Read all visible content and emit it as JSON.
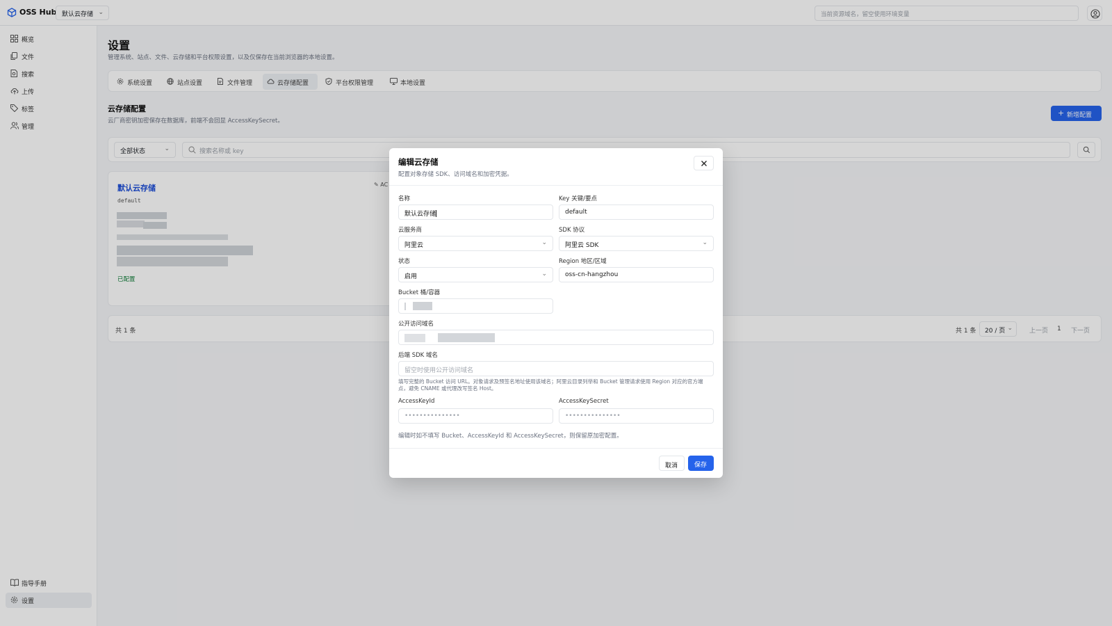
{
  "app": {
    "title": "OSS Hub",
    "bucket_select": "默认云存储"
  },
  "top_search": {
    "placeholder": "当前资源域名，留空使用环境变量"
  },
  "sidebar": {
    "items": [
      {
        "label": "概览",
        "icon": "grid-icon"
      },
      {
        "label": "文件",
        "icon": "files-icon"
      },
      {
        "label": "搜索",
        "icon": "file-search-icon"
      },
      {
        "label": "上传",
        "icon": "cloud-upload-icon"
      },
      {
        "label": "标签",
        "icon": "tags-icon"
      },
      {
        "label": "管理",
        "icon": "users-icon"
      }
    ],
    "bottom": [
      {
        "label": "指导手册",
        "icon": "book-icon"
      },
      {
        "label": "设置",
        "icon": "gear-icon"
      }
    ]
  },
  "page": {
    "title": "设置",
    "subtitle": "管理系统、站点、文件、云存储和平台权限设置，以及仅保存在当前浏览器的本地设置。"
  },
  "tabs": [
    {
      "label": "系统设置",
      "icon": "gear-icon"
    },
    {
      "label": "站点设置",
      "icon": "globe-icon"
    },
    {
      "label": "文件管理",
      "icon": "file-icon"
    },
    {
      "label": "云存储配置",
      "icon": "cloud-icon",
      "active": true
    },
    {
      "label": "平台权限管理",
      "icon": "shield-icon"
    },
    {
      "label": "本地设置",
      "icon": "monitor-icon"
    }
  ],
  "section": {
    "title": "云存储配置",
    "subtitle": "云厂商密钥加密保存在数据库，前端不会回显 AccessKeySecret。",
    "add_button": "新增配置"
  },
  "filter": {
    "status": "全部状态",
    "search_placeholder": "搜索名称或 key"
  },
  "card": {
    "title": "默认云存储",
    "key": "default",
    "edit_label": "AC",
    "status": "已配置"
  },
  "pagination": {
    "total_left": "共 1 条",
    "total_right": "共 1 条",
    "page_size": "20 / 页",
    "prev": "上一页",
    "current": "1",
    "next": "下一页"
  },
  "modal": {
    "title": "编辑云存储",
    "subtitle": "配置对象存储 SDK、访问域名和加密凭据。",
    "fields": {
      "name": {
        "label": "名称",
        "value": "默认云存储"
      },
      "key": {
        "label": "Key 关键/要点",
        "value": "default"
      },
      "provider": {
        "label": "云服务商",
        "value": "阿里云"
      },
      "sdk": {
        "label": "SDK 协议",
        "value": "阿里云 SDK"
      },
      "status": {
        "label": "状态",
        "value": "启用"
      },
      "region": {
        "label": "Region 地区/区域",
        "value": "oss-cn-hangzhou"
      },
      "bucket": {
        "label": "Bucket 桶/容器"
      },
      "public_domain": {
        "label": "公开访问域名"
      },
      "sdk_domain": {
        "label": "后端 SDK 域名",
        "placeholder": "留空时使用公开访问域名"
      },
      "access_key_id": {
        "label": "AccessKeyId",
        "placeholder": "•••••••••••••••"
      },
      "access_key_secret": {
        "label": "AccessKeySecret",
        "placeholder": "•••••••••••••••"
      }
    },
    "sdk_hint": "填写完整的 Bucket 访问 URL。对象请求及预签名地址使用该域名；阿里云目录列举和 Bucket 管理请求使用 Region 对应的官方端点，避免 CNAME 或代理改写签名 Host。",
    "note": "编辑时如不填写 Bucket、AccessKeyId 和 AccessKeySecret，则保留原加密配置。",
    "cancel": "取消",
    "save": "保存"
  },
  "colors": {
    "accent": "#2563eb",
    "success": "#15803d"
  }
}
